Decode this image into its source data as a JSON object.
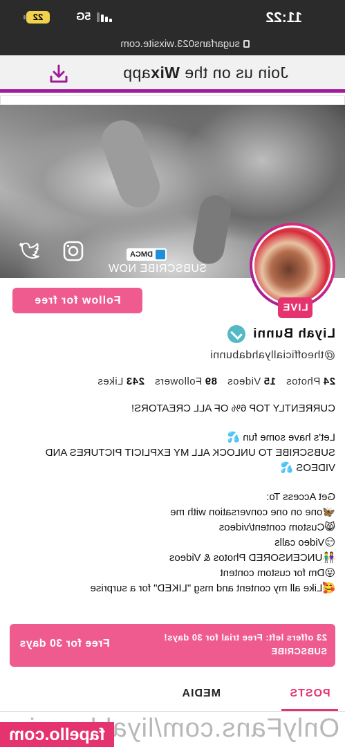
{
  "status_bar": {
    "time": "11:22",
    "network": "5G",
    "battery": "22"
  },
  "browser": {
    "url": "sugarfans023.wixsite.com"
  },
  "wix_banner": {
    "text_prefix": "Join us on the ",
    "brand": "Wix",
    "text_suffix": "app"
  },
  "header_banner": {
    "subscribe_text": "SUBSCRIBE NOW",
    "dmca_text": "DMCA"
  },
  "profile": {
    "live_badge": "LIVE",
    "follow_button": "Follow for free",
    "name": "Liyah Bunni",
    "handle": "@theofficiallyahdabunni",
    "stats": {
      "photos_count": "24",
      "photos_label": "Photos",
      "videos_count": "15",
      "videos_label": "Videos",
      "followers_count": "89",
      "followers_label": "Followers",
      "likes_count": "243",
      "likes_label": "Likes"
    }
  },
  "bio": {
    "line1": "CURRENTLY TOP 6% OF ALL CREATORS!",
    "line2": "Let's have some fun 💦",
    "line3": "SUBSCRIBE TO UNLOCK ALL MY EXPLICIT PICTURES AND VIDEOS 💦",
    "access_heading": "Get Access To:",
    "items": [
      "🦋one on one conversation with me",
      "😸Custom content/videos",
      "😏Video calls",
      "👫UNCENSORED Photos & Videos",
      "😜Dm for custom content",
      "🥰Like all my content and msg \"LIKED\" for a surprise"
    ]
  },
  "offer": {
    "offers_left": "23 offers left: Free trial for 30 days!",
    "subscribe": "SUBSCRIBE",
    "price": "Free for 30 days"
  },
  "tabs": {
    "posts": "POSTS",
    "media": "MEDIA"
  },
  "watermark": {
    "text": "OnlyFans.com/liyahbunni",
    "site": "fapello.com"
  },
  "colors": {
    "accent_pink": "#ef5b8e",
    "wix_purple": "#a01b9a",
    "verified_teal": "#54b8c5"
  }
}
